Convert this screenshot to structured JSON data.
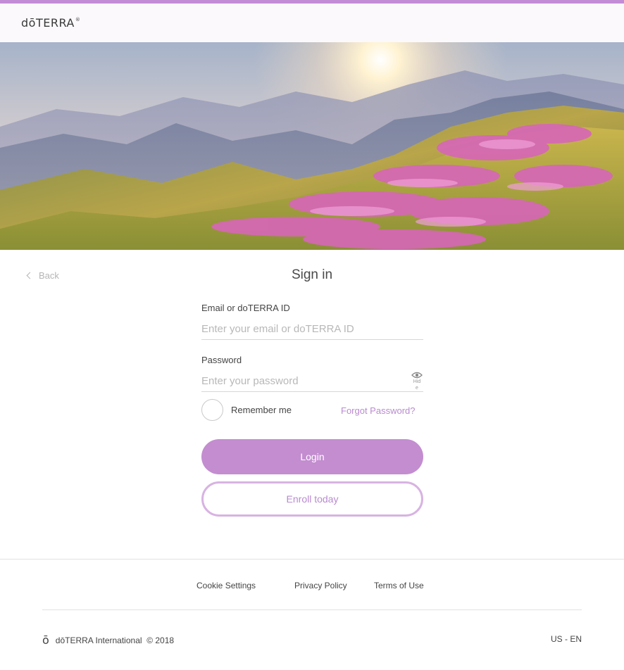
{
  "header": {
    "logo_text": "dōTERRA",
    "logo_reg": "®"
  },
  "back": {
    "label": "Back"
  },
  "signin": {
    "title": "Sign in",
    "email_label": "Email or doTERRA ID",
    "email_placeholder": "Enter your email or doTERRA ID",
    "password_label": "Password",
    "password_placeholder": "Enter your password",
    "hide_label": "Hide",
    "remember_label": "Remember me",
    "forgot_label": "Forgot Password?",
    "login_label": "Login",
    "enroll_label": "Enroll today"
  },
  "footer": {
    "links": [
      "Cookie Settings",
      "Privacy Policy",
      "Terms of Use"
    ],
    "brand_mark": "ō",
    "brand_text": "dōTERRA International  © 2018",
    "locale": "US - EN"
  },
  "colors": {
    "accent": "#c38dd0",
    "accent_text": "#b98ad0",
    "topbar": "#c38dd6"
  }
}
